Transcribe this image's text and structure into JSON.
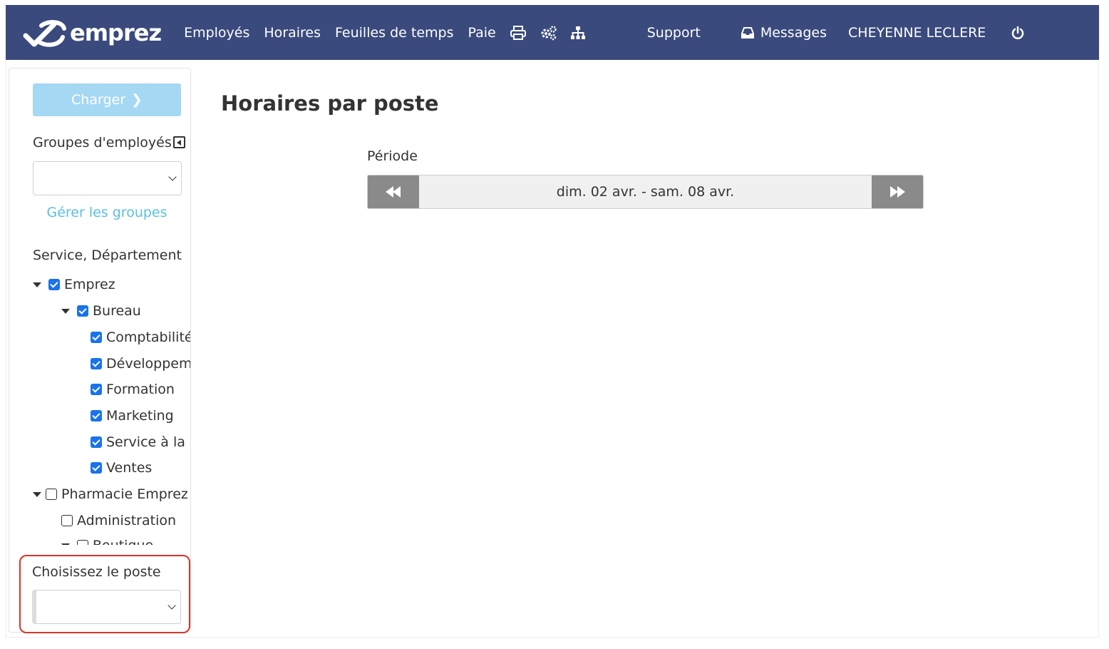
{
  "brand": {
    "name": "emprez",
    "bar_color": "#3a4a7c"
  },
  "nav": {
    "employes": "Employés",
    "horaires": "Horaires",
    "feuilles": "Feuilles de temps",
    "paie": "Paie",
    "icons": [
      "print-icon",
      "gears-icon",
      "org-chart-icon"
    ],
    "support": "Support",
    "messages": "Messages",
    "user": "CHEYENNE LECLERE",
    "power_icon": "power-icon"
  },
  "sidebar": {
    "charger_label": "Charger",
    "groups_label": "Groupes d'employés",
    "groups_value": "",
    "manage_groups": "Gérer les groupes",
    "service_label": "Service, Département",
    "tree": [
      {
        "label": "Emprez",
        "checked": true,
        "arrow": true
      },
      {
        "label": "Bureau",
        "checked": true,
        "arrow": true
      },
      {
        "label": "Comptabilité",
        "checked": true,
        "arrow": false
      },
      {
        "label": "Développement",
        "checked": true,
        "arrow": false
      },
      {
        "label": "Formation",
        "checked": true,
        "arrow": false
      },
      {
        "label": "Marketing",
        "checked": true,
        "arrow": false
      },
      {
        "label": "Service à la clientèle",
        "checked": true,
        "arrow": false
      },
      {
        "label": "Ventes",
        "checked": true,
        "arrow": false
      },
      {
        "label": "Pharmacie Emprez",
        "checked": false,
        "arrow": true
      },
      {
        "label": "Administration",
        "checked": false,
        "arrow": false
      },
      {
        "label": "Boutique",
        "checked": false,
        "arrow": true
      }
    ],
    "poste_label": "Choisissez le poste",
    "poste_value": ""
  },
  "main": {
    "title": "Horaires par poste",
    "period_label": "Période",
    "period_value": "dim. 02 avr. - sam. 08 avr."
  },
  "colors": {
    "accent_link": "#5bc0de",
    "checkbox": "#1a73e8",
    "highlight": "#d9342b"
  }
}
